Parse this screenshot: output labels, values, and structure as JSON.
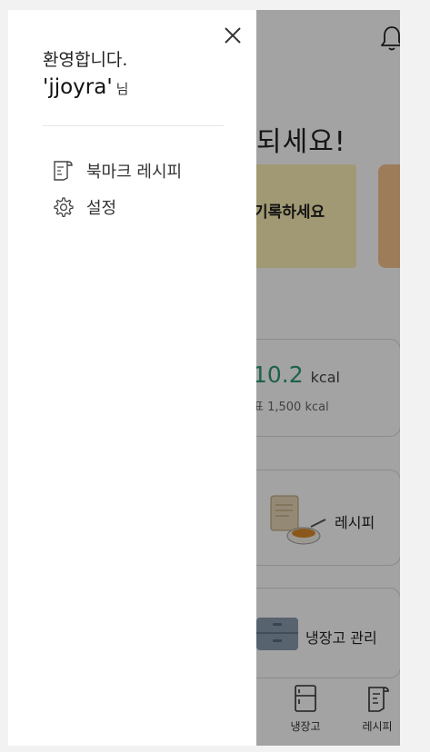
{
  "drawer": {
    "welcome": "환영합니다.",
    "username": "'jjoyra'",
    "honorific": "님",
    "menu": [
      {
        "label": "북마크 레시피",
        "icon": "bookmark-recipe-icon"
      },
      {
        "label": "설정",
        "icon": "gear-icon"
      }
    ]
  },
  "background": {
    "headline": "되세요!",
    "banner_text": "기록하세요",
    "calories": {
      "value": "10.2",
      "unit": "kcal",
      "goal": "표 1,500 kcal"
    },
    "recipe_card_label": "레시피",
    "fridge_card_label": "냉장고 관리",
    "tabs": [
      {
        "label": "냉장고",
        "icon": "fridge-icon"
      },
      {
        "label": "레시피",
        "icon": "recipe-icon"
      }
    ]
  },
  "colors": {
    "overlay": "rgba(0,0,0,0.36)",
    "accent_green": "#2e9a73",
    "banner_yellow": "#fbf0b4",
    "banner_orange": "#f6c48c"
  }
}
